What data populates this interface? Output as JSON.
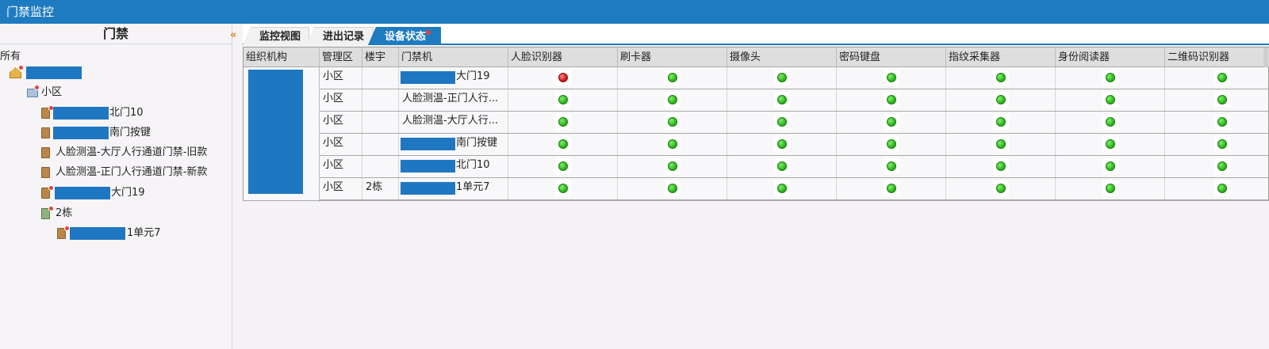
{
  "window": {
    "title": "门禁监控"
  },
  "sidebar": {
    "title": "门禁",
    "collapse_icon": "«",
    "root_label": "所有",
    "nodes": [
      {
        "label": "",
        "icon": "home-icon",
        "redacted": true
      },
      {
        "label": "小区",
        "icon": "group-icon"
      },
      {
        "label": "北门10",
        "icon": "door-icon",
        "redacted": true
      },
      {
        "label": "南门按键",
        "icon": "door-icon",
        "redacted": true
      },
      {
        "label": "人脸测温-大厅人行通道门禁-旧款",
        "icon": "door-icon"
      },
      {
        "label": "人脸测温-正门人行通道门禁-新款",
        "icon": "door-icon"
      },
      {
        "label": "大门19",
        "icon": "door-icon",
        "redacted": true
      },
      {
        "label": "2栋",
        "icon": "building-icon"
      },
      {
        "label": "1单元7",
        "icon": "door-icon",
        "redacted": true
      }
    ]
  },
  "tabs": [
    {
      "label": "监控视图"
    },
    {
      "label": "进出记录"
    },
    {
      "label": "设备状态",
      "active": true
    }
  ],
  "table": {
    "columns": [
      "组织机构",
      "管理区",
      "楼宇",
      "门禁机",
      "人脸识别器",
      "刷卡器",
      "摄像头",
      "密码键盘",
      "指纹采集器",
      "身份阅读器",
      "二维码识别器"
    ],
    "rows": [
      {
        "zone": "小区",
        "building": "",
        "door": "大门19",
        "door_redacted": true,
        "status": [
          "red",
          "green",
          "green",
          "green",
          "green",
          "green",
          "green"
        ]
      },
      {
        "zone": "小区",
        "building": "",
        "door": "人脸测温-正门人行...",
        "door_redacted": false,
        "status": [
          "green",
          "green",
          "green",
          "green",
          "green",
          "green",
          "green"
        ]
      },
      {
        "zone": "小区",
        "building": "",
        "door": "人脸测温-大厅人行...",
        "door_redacted": false,
        "status": [
          "green",
          "green",
          "green",
          "green",
          "green",
          "green",
          "green"
        ]
      },
      {
        "zone": "小区",
        "building": "",
        "door": "南门按键",
        "door_redacted": true,
        "status": [
          "green",
          "green",
          "green",
          "green",
          "green",
          "green",
          "green"
        ]
      },
      {
        "zone": "小区",
        "building": "",
        "door": "北门10",
        "door_redacted": true,
        "status": [
          "green",
          "green",
          "green",
          "green",
          "green",
          "green",
          "green"
        ]
      },
      {
        "zone": "小区",
        "building": "2栋",
        "door": "1单元7",
        "door_redacted": true,
        "status": [
          "green",
          "green",
          "green",
          "green",
          "green",
          "green",
          "green"
        ]
      }
    ]
  },
  "colors": {
    "accent": "#1e7bbf",
    "status_green": "#2fb51e",
    "status_red": "#d61818"
  }
}
